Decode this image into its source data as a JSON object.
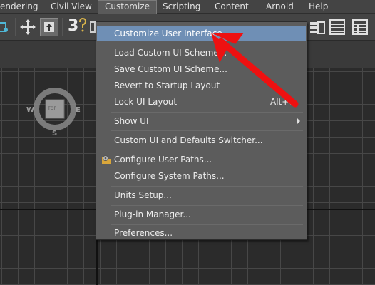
{
  "menubar": {
    "items": [
      {
        "label": "endering"
      },
      {
        "label": "Civil View"
      },
      {
        "label": "Customize",
        "active": true
      },
      {
        "label": "Scripting"
      },
      {
        "label": "Content"
      },
      {
        "label": "Arnold"
      },
      {
        "label": "Help"
      }
    ]
  },
  "toolbar": {
    "snap_label": "3"
  },
  "viewcube": {
    "face": "TOP",
    "west": "W",
    "east": "E",
    "south": "S"
  },
  "dropdown": {
    "items": [
      {
        "label": "Customize User Interface...",
        "highlighted": true
      },
      {
        "label": "Load Custom UI Scheme..."
      },
      {
        "label": "Save Custom UI Scheme..."
      },
      {
        "label": "Revert to Startup Layout"
      },
      {
        "label": "Lock UI Layout",
        "shortcut": "Alt+0"
      },
      {
        "label": "Show UI",
        "submenu": true
      },
      {
        "label": "Custom UI and Defaults Switcher..."
      },
      {
        "label": "Configure User Paths...",
        "icon": "folder-gear-icon"
      },
      {
        "label": "Configure System Paths..."
      },
      {
        "label": "Units Setup..."
      },
      {
        "label": "Plug-in Manager..."
      },
      {
        "label": "Preferences..."
      }
    ]
  },
  "colors": {
    "menu_highlight": "#6f8fb5",
    "annotation_arrow": "#ee1111"
  }
}
